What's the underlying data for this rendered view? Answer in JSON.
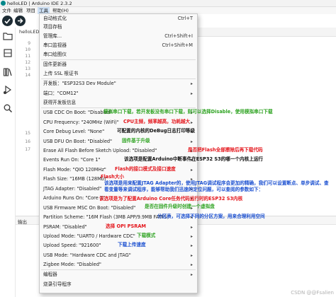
{
  "window": {
    "title": "helloLED | Arduino IDE 2.3.2"
  },
  "menubar": [
    "文件",
    "编辑",
    "项目",
    "工具",
    "帮助(H)"
  ],
  "editor": {
    "tab": "helloLED",
    "line_numbers": [
      "9",
      "10",
      "11",
      "12",
      "13",
      "14",
      "15",
      "16",
      "17"
    ]
  },
  "output": {
    "tab_label": "输出"
  },
  "tools_menu": {
    "auto_format": {
      "label": "自动格式化",
      "shortcut": "Ctrl+T"
    },
    "archive_sketch": {
      "label": "项目存档"
    },
    "manage_libraries": {
      "label": "管理库...",
      "shortcut": "Ctrl+Shift+I"
    },
    "serial_monitor": {
      "label": "串口监视器",
      "shortcut": "Ctrl+Shift+M"
    },
    "serial_plotter": {
      "label": "串口绘图仪"
    },
    "firmware_updater": {
      "label": "固件更新器"
    },
    "upload_ssl": {
      "label": "上传 SSL 根证书"
    },
    "board": {
      "label": "开发板：\"ESP32S3 Dev Module\""
    },
    "port": {
      "label": "端口：\"COM12\""
    },
    "board_info": {
      "label": "获得开发板信息"
    },
    "usb_cdc": {
      "label": "USB CDC On Boot: \"Disabled\""
    },
    "cpu_freq": {
      "label": "CPU Frequency: \"240MHz (WiFi)\""
    },
    "core_debug": {
      "label": "Core Debug Level: \"None\""
    },
    "usb_dfu": {
      "label": "USB DFU On Boot: \"Disabled\""
    },
    "erase_flash": {
      "label": "Erase All Flash Before Sketch Upload: \"Disabled\""
    },
    "events_run_on": {
      "label": "Events Run On: \"Core 1\""
    },
    "flash_mode": {
      "label": "Flash Mode: \"QIO 120MHz\""
    },
    "flash_size": {
      "label": "Flash Size: \"16MB (128Mb)\""
    },
    "jtag_adapter": {
      "label": "JTAG Adapter: \"Disabled\""
    },
    "arduino_runs_on": {
      "label": "Arduino Runs On: \"Core 1\""
    },
    "usb_msc": {
      "label": "USB Firmware MSC On Boot: \"Disabled\""
    },
    "partition": {
      "label": "Partition Scheme: \"16M Flash (3MB APP/9.9MB FATFS)\""
    },
    "psram": {
      "label": "PSRAM: \"Disabled\""
    },
    "upload_mode": {
      "label": "Upload Mode: \"UART0 / Hardware CDC\""
    },
    "upload_speed": {
      "label": "Upload Speed: \"921600\""
    },
    "usb_mode": {
      "label": "USB Mode: \"Hardware CDC and JTAG\""
    },
    "zigbee_mode": {
      "label": "Zigbee Mode: \"Disabled\""
    },
    "programmer": {
      "label": "编程器"
    },
    "burn_bootloader": {
      "label": "烧录引导程序"
    }
  },
  "annotations": {
    "usb_cdc": "模拟串口下载，若开发板没有串口下载，则可以选择Disable，使用模拟串口下载",
    "cpu_freq": "CPU主频，频率越高，功耗越大",
    "core_debug": "可配置的内核的DeBug日志打印等级",
    "usb_dfu": "固件基于升级",
    "erase_flash": "是否把Flash全部擦除后再下载代码",
    "events_run_on": "该选项是配置Arduino中断事件在ESP32 S3的哪一个内核上运行",
    "flash_mode": "Flash的接口模式及接口速度",
    "flash_size": "Flash大小",
    "jtag_adapter": "该选项是用来配置JTAG Adapter的，使用JTAG调试程序会更加的精确，我们可以设置断点、单步调试、查看变量等来调试程序，能够帮助我们迅速的定位问题，可以查阅的参数如下：",
    "arduino_runs_on": "该选项是为了配置Arduino Core任务代码运行时的ESP32 S3内核",
    "usb_msc": "是否在固件升级时创建一个虚拟盘",
    "partition": "分区表，可选择不同的分区方案，用来合理利用空间",
    "psram": "选择 OPI PSRAM",
    "upload_mode": "下载模式",
    "upload_speed": "下载上传速度"
  },
  "watermark": "CSDN @@Fsalien"
}
